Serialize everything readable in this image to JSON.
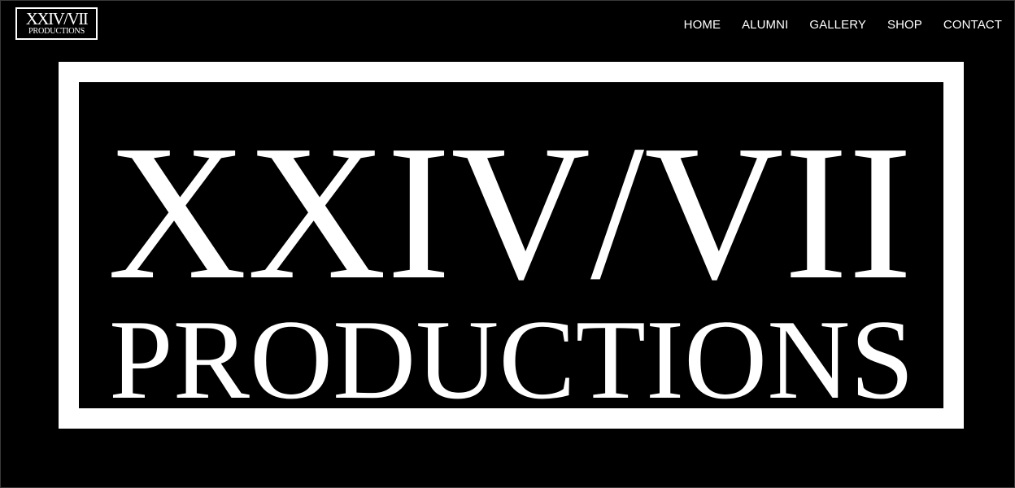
{
  "header": {
    "logo": {
      "line1": "XXIV/VII",
      "line2": "PRODUCTIONS"
    },
    "nav": [
      {
        "label": "HOME"
      },
      {
        "label": "ALUMNI"
      },
      {
        "label": "GALLERY"
      },
      {
        "label": "SHOP"
      },
      {
        "label": "CONTACT"
      }
    ]
  },
  "hero": {
    "line1": "XXIV/VII",
    "line2": "PRODUCTIONS"
  },
  "colors": {
    "background": "#000000",
    "foreground": "#ffffff"
  }
}
